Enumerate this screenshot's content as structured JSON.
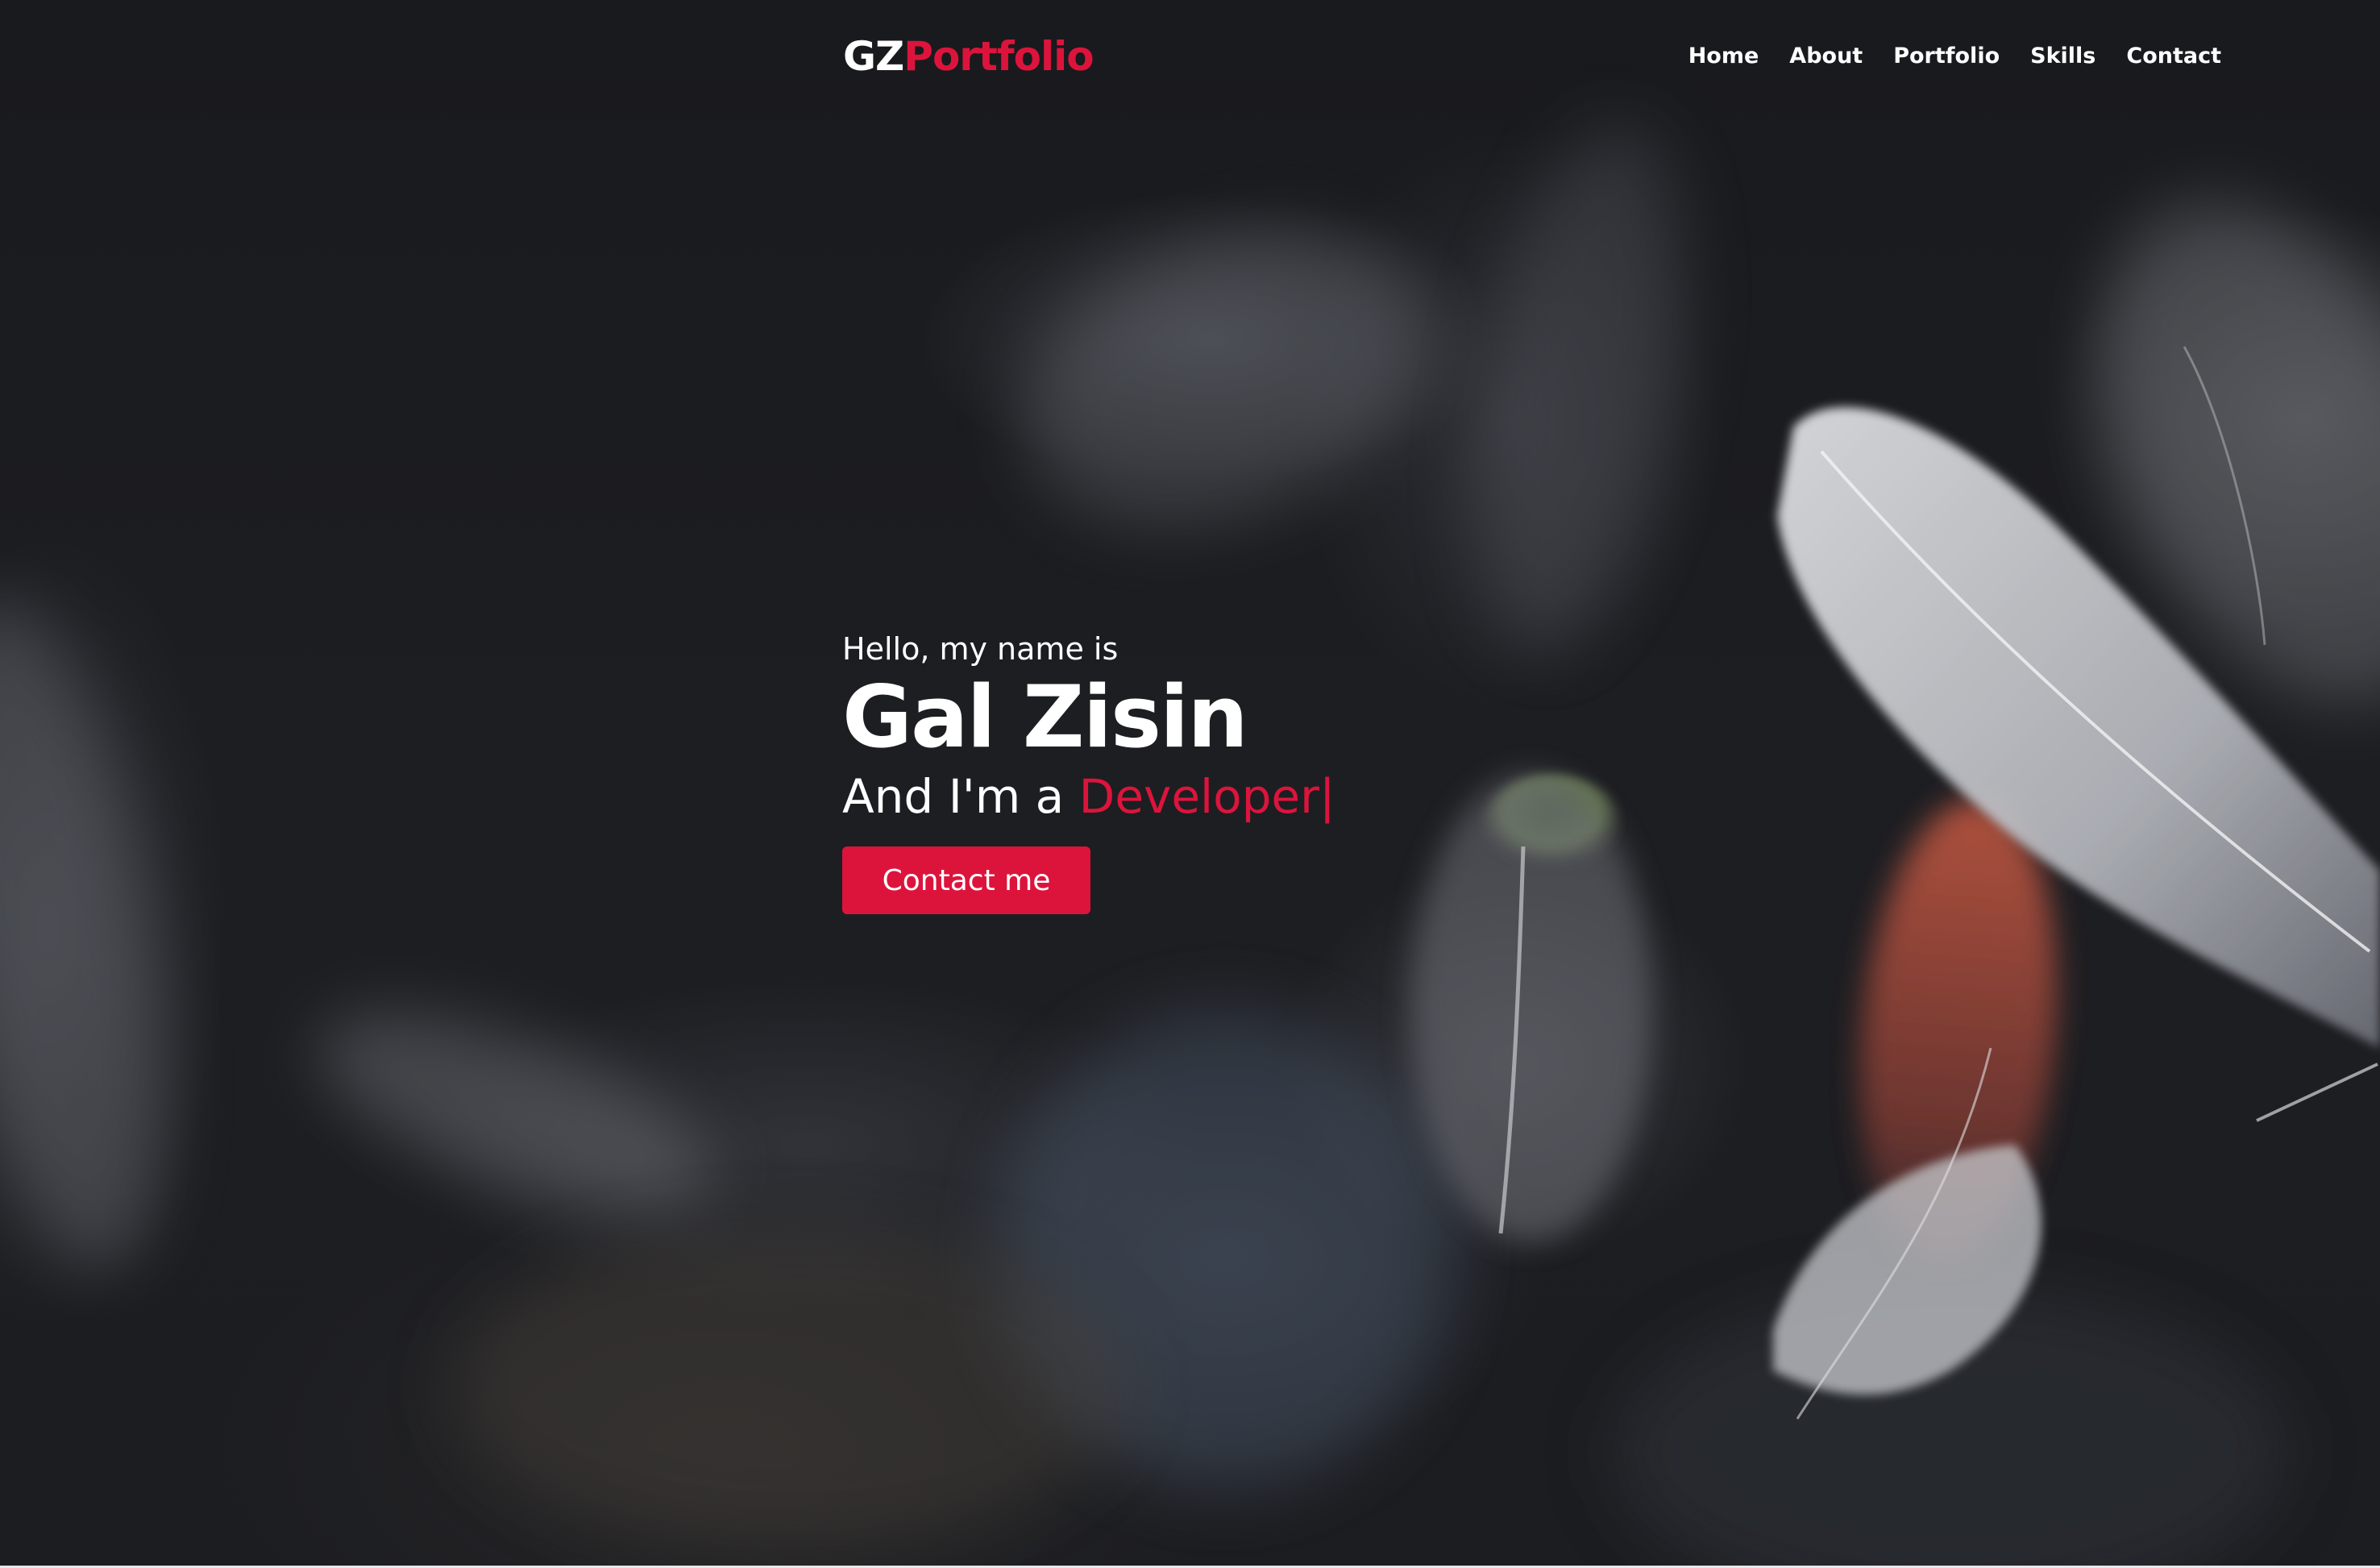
{
  "brand": {
    "logo_prefix": "GZ",
    "logo_suffix": "Portfolio",
    "accent_color": "#dc143c"
  },
  "nav": {
    "items": [
      {
        "label": "Home"
      },
      {
        "label": "About"
      },
      {
        "label": "Portfolio"
      },
      {
        "label": "Skills"
      },
      {
        "label": "Contact"
      }
    ]
  },
  "hero": {
    "greeting": "Hello, my name is",
    "name": "Gal Zisin",
    "role_prefix": "And I'm a ",
    "role_typed": "Developer|",
    "cta_label": "Contact me"
  },
  "background": {
    "description_icon": "feathers-photo"
  }
}
